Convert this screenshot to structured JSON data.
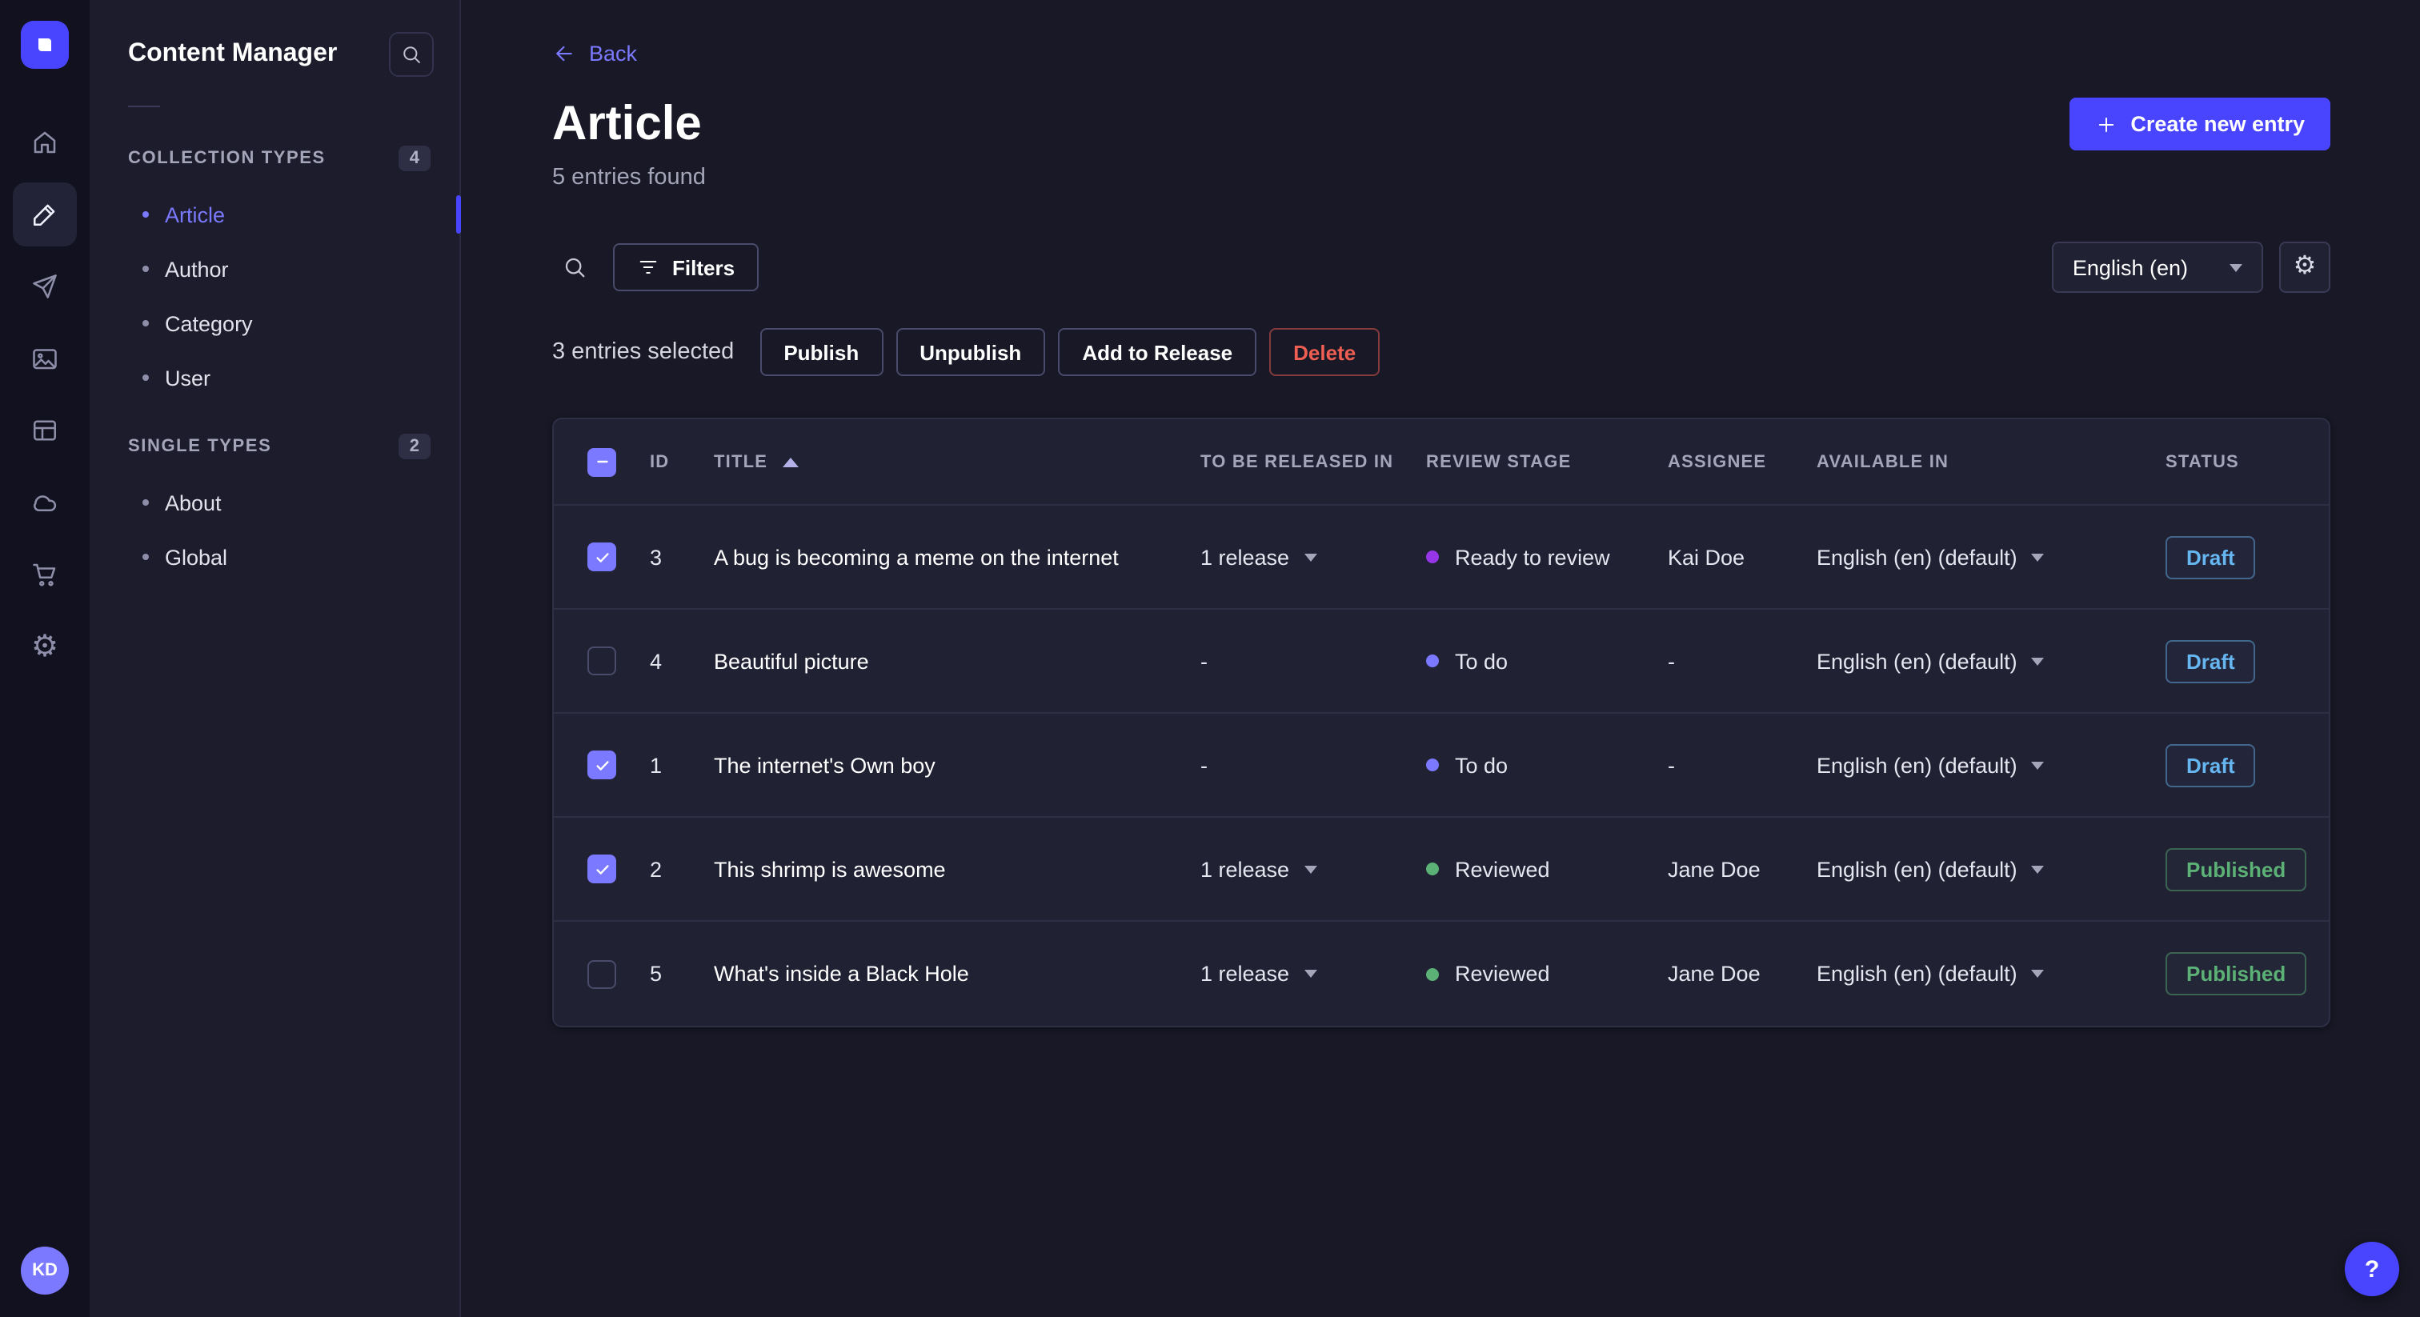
{
  "colors": {
    "primary": "#4945ff",
    "primary_light": "#7b79ff",
    "success": "#5cb176",
    "danger": "#ee5e52",
    "draft_badge": "#66b7f1",
    "table_bg": "#212134",
    "page_bg": "#181826"
  },
  "rail": {
    "icons": [
      "strapi-logo",
      "home-icon",
      "content-manager-icon",
      "releases-icon",
      "media-library-icon",
      "content-type-builder-icon",
      "cloud-icon",
      "marketplace-icon",
      "settings-icon"
    ],
    "active_icon": "content-manager-icon",
    "avatar_initials": "KD"
  },
  "sidebar": {
    "title": "Content Manager",
    "sections": [
      {
        "label": "COLLECTION TYPES",
        "count": "4",
        "items": [
          {
            "label": "Article",
            "active": true
          },
          {
            "label": "Author",
            "active": false
          },
          {
            "label": "Category",
            "active": false
          },
          {
            "label": "User",
            "active": false
          }
        ]
      },
      {
        "label": "SINGLE TYPES",
        "count": "2",
        "items": [
          {
            "label": "About",
            "active": false
          },
          {
            "label": "Global",
            "active": false
          }
        ]
      }
    ]
  },
  "header": {
    "back": "Back",
    "title": "Article",
    "subtitle": "5 entries found",
    "create_button": "Create new entry"
  },
  "toolbar": {
    "filters": "Filters",
    "locale": "English (en)"
  },
  "selection": {
    "label": "3 entries selected",
    "publish": "Publish",
    "unpublish": "Unpublish",
    "add_to_release": "Add to Release",
    "delete": "Delete"
  },
  "table": {
    "columns": {
      "id": "ID",
      "title": "TITLE",
      "release": "TO BE RELEASED IN",
      "stage": "REVIEW STAGE",
      "assignee": "ASSIGNEE",
      "available": "AVAILABLE IN",
      "status": "STATUS"
    },
    "rows": [
      {
        "checked": true,
        "id": "3",
        "title": "A bug is becoming a meme on the internet",
        "release": "1 release",
        "stage": "Ready to review",
        "stage_color": "#9736e8",
        "assignee": "Kai Doe",
        "available": "English (en) (default)",
        "status": "Draft"
      },
      {
        "checked": false,
        "id": "4",
        "title": "Beautiful picture",
        "release": "-",
        "stage": "To do",
        "stage_color": "#7b79ff",
        "assignee": "-",
        "available": "English (en) (default)",
        "status": "Draft"
      },
      {
        "checked": true,
        "id": "1",
        "title": "The internet's Own boy",
        "release": "-",
        "stage": "To do",
        "stage_color": "#7b79ff",
        "assignee": "-",
        "available": "English (en) (default)",
        "status": "Draft"
      },
      {
        "checked": true,
        "id": "2",
        "title": "This shrimp is awesome",
        "release": "1 release",
        "stage": "Reviewed",
        "stage_color": "#5cb176",
        "assignee": "Jane Doe",
        "available": "English (en) (default)",
        "status": "Published"
      },
      {
        "checked": false,
        "id": "5",
        "title": "What's inside a Black Hole",
        "release": "1 release",
        "stage": "Reviewed",
        "stage_color": "#5cb176",
        "assignee": "Jane Doe",
        "available": "English (en) (default)",
        "status": "Published"
      }
    ]
  },
  "help": {
    "label": "?"
  }
}
